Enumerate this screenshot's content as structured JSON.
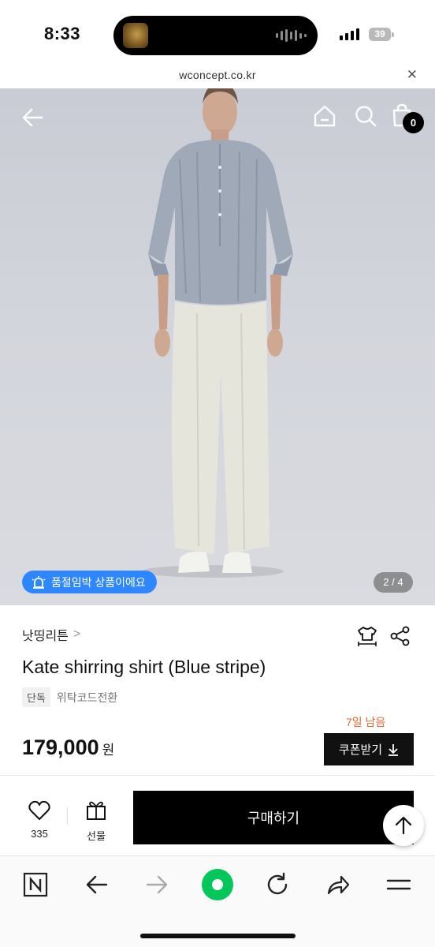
{
  "status_bar": {
    "time": "8:33",
    "battery": "39"
  },
  "url_bar": {
    "url": "wconcept.co.kr",
    "close_icon": "close-icon"
  },
  "hero": {
    "cart_count": "0",
    "notice": "품절임박 상품이에요",
    "page_indicator": "2 / 4",
    "icons": [
      "back-arrow-icon",
      "home-icon",
      "search-icon",
      "shopping-bag-icon"
    ]
  },
  "product": {
    "brand": "낫띵리튼",
    "name": "Kate shirring shirt (Blue stripe)",
    "tag_exclusive": "단독",
    "tag_code": "위탁코드전환",
    "days_left": "7일 남음",
    "price": "179,000",
    "currency": "원",
    "coupon_label": "쿠폰받기"
  },
  "actions": {
    "like_count": "335",
    "gift_label": "선물",
    "buy_label": "구매하기"
  },
  "browser_toolbar": {
    "icons": [
      "naver-n-icon",
      "back-icon",
      "forward-icon",
      "green-home-icon",
      "refresh-icon",
      "share-icon",
      "menu-icon"
    ]
  },
  "colors": {
    "notice_blue": "#2f87ff",
    "days_left_orange": "#e2662e",
    "browser_green": "#03c75a"
  }
}
